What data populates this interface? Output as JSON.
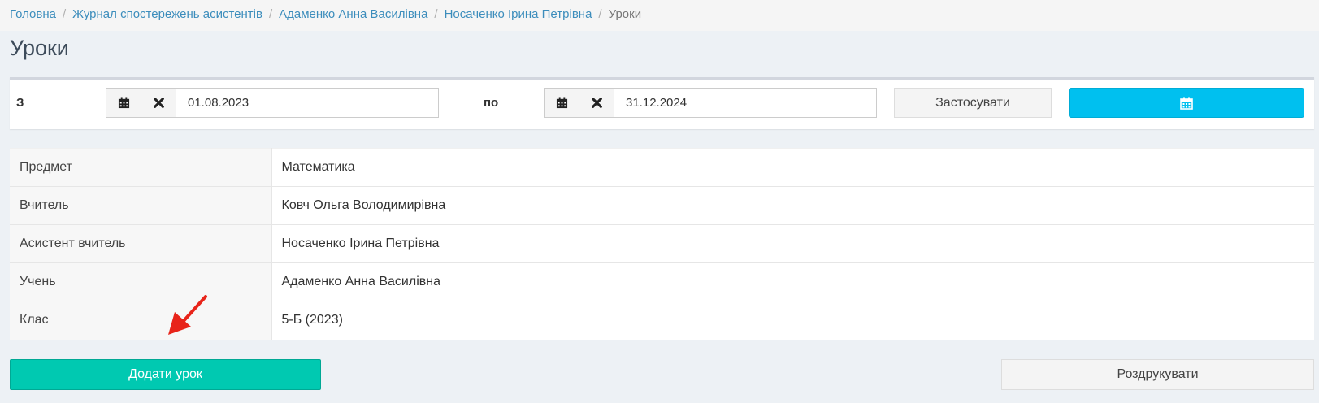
{
  "breadcrumb": [
    {
      "label": "Головна"
    },
    {
      "label": "Журнал спостережень асистентів"
    },
    {
      "label": "Адаменко Анна Василівна"
    },
    {
      "label": "Носаченко Ірина Петрівна"
    },
    {
      "label": "Уроки"
    }
  ],
  "page": {
    "title": "Уроки"
  },
  "filter": {
    "from_label": "З",
    "from_value": "01.08.2023",
    "to_label": "по",
    "to_value": "31.12.2024",
    "apply_label": "Застосувати"
  },
  "info": [
    {
      "key": "Предмет",
      "value": "Математика"
    },
    {
      "key": "Вчитель",
      "value": "Ковч Ольга Володимирівна"
    },
    {
      "key": "Асистент вчитель",
      "value": "Носаченко Ірина Петрівна"
    },
    {
      "key": "Учень",
      "value": "Адаменко Анна Василівна"
    },
    {
      "key": "Клас",
      "value": "5-Б (2023)"
    }
  ],
  "actions": {
    "add_label": "Додати урок",
    "print_label": "Роздрукувати"
  },
  "colors": {
    "link": "#3c8dbc",
    "info_button": "#00c0ef",
    "add_button": "#00c9b1",
    "annotation_arrow": "#e8241a"
  },
  "icons": [
    "calendar-icon",
    "close-icon",
    "red-arrow-annotation"
  ]
}
